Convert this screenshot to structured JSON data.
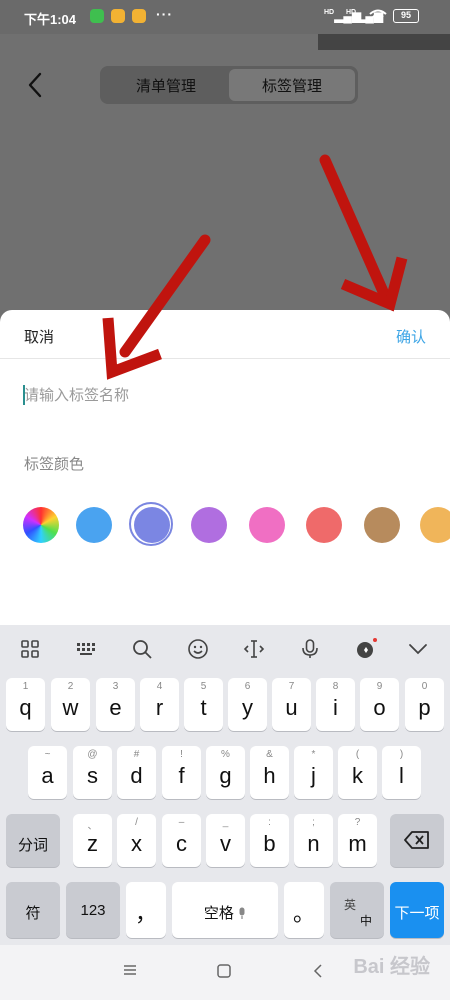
{
  "status_bar": {
    "time": "下午1:04",
    "dots": "···",
    "signal1": "HD",
    "signal2": "HD",
    "battery": "95"
  },
  "header": {
    "tabs": [
      {
        "label": "清单管理",
        "active": false
      },
      {
        "label": "标签管理",
        "active": true
      }
    ]
  },
  "sheet": {
    "cancel_label": "取消",
    "confirm_label": "确认",
    "name_placeholder": "请输入标签名称",
    "color_label": "标签颜色",
    "swatches": [
      {
        "name": "rainbow",
        "color": "conic-gradient"
      },
      {
        "name": "blue",
        "color": "#4aa3f0"
      },
      {
        "name": "indigo",
        "color": "#7b86e3",
        "selected": true
      },
      {
        "name": "purple",
        "color": "#b06ee0"
      },
      {
        "name": "pink",
        "color": "#f06fc3"
      },
      {
        "name": "red",
        "color": "#ef6a6a"
      },
      {
        "name": "brown",
        "color": "#b78b5d"
      },
      {
        "name": "orange",
        "color": "#f0b55a"
      }
    ]
  },
  "keyboard": {
    "row1": [
      {
        "hint": "1",
        "key": "q"
      },
      {
        "hint": "2",
        "key": "w"
      },
      {
        "hint": "3",
        "key": "e"
      },
      {
        "hint": "4",
        "key": "r"
      },
      {
        "hint": "5",
        "key": "t"
      },
      {
        "hint": "6",
        "key": "y"
      },
      {
        "hint": "7",
        "key": "u"
      },
      {
        "hint": "8",
        "key": "i"
      },
      {
        "hint": "9",
        "key": "o"
      },
      {
        "hint": "0",
        "key": "p"
      }
    ],
    "row2": [
      {
        "hint": "~",
        "key": "a"
      },
      {
        "hint": "@",
        "key": "s"
      },
      {
        "hint": "#",
        "key": "d"
      },
      {
        "hint": "!",
        "key": "f"
      },
      {
        "hint": "%",
        "key": "g"
      },
      {
        "hint": "&",
        "key": "h"
      },
      {
        "hint": "*",
        "key": "j"
      },
      {
        "hint": "(",
        "key": "k"
      },
      {
        "hint": ")",
        "key": "l"
      }
    ],
    "row3": [
      {
        "hint": "、",
        "key": "z"
      },
      {
        "hint": "/",
        "key": "x"
      },
      {
        "hint": "–",
        "key": "c"
      },
      {
        "hint": "_",
        "key": "v"
      },
      {
        "hint": ":",
        "key": "b"
      },
      {
        "hint": ";",
        "key": "n"
      },
      {
        "hint": "?",
        "key": "m"
      }
    ],
    "fenci": "分词",
    "fu": "符",
    "num": "123",
    "comma": "，",
    "space": "空格",
    "period": "。",
    "lang_top": "英",
    "lang_bottom": "中",
    "next": "下一项"
  },
  "watermark": "Bai 经验"
}
